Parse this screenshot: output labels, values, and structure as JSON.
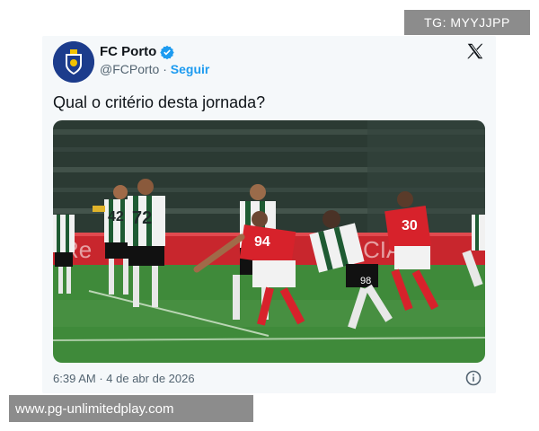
{
  "post": {
    "display_name": "FC Porto",
    "handle": "@FCPorto",
    "separator": "·",
    "follow_label": "Seguir",
    "text": "Qual o critério desta jornada?",
    "time": "6:39 AM",
    "date": "4 de abr de 2026",
    "media": {
      "description_icon": "football-match-photo",
      "player_numbers": [
        "42",
        "72",
        "94",
        "30"
      ],
      "ad_board_text": "Re CIA"
    },
    "icons": {
      "verified": "verified-badge-icon",
      "platform": "x-logo-icon",
      "info": "info-icon"
    }
  },
  "watermarks": {
    "top_right": "TG: MYYJJPP",
    "bottom_left": "www.pg-unlimitedplay.com"
  },
  "colors": {
    "accent": "#1d9bf0",
    "card_bg": "#f5f8fa",
    "text": "#0f1419",
    "muted": "#536471",
    "pitch": "#3f8a3a",
    "home_kit": "#d7222b"
  }
}
